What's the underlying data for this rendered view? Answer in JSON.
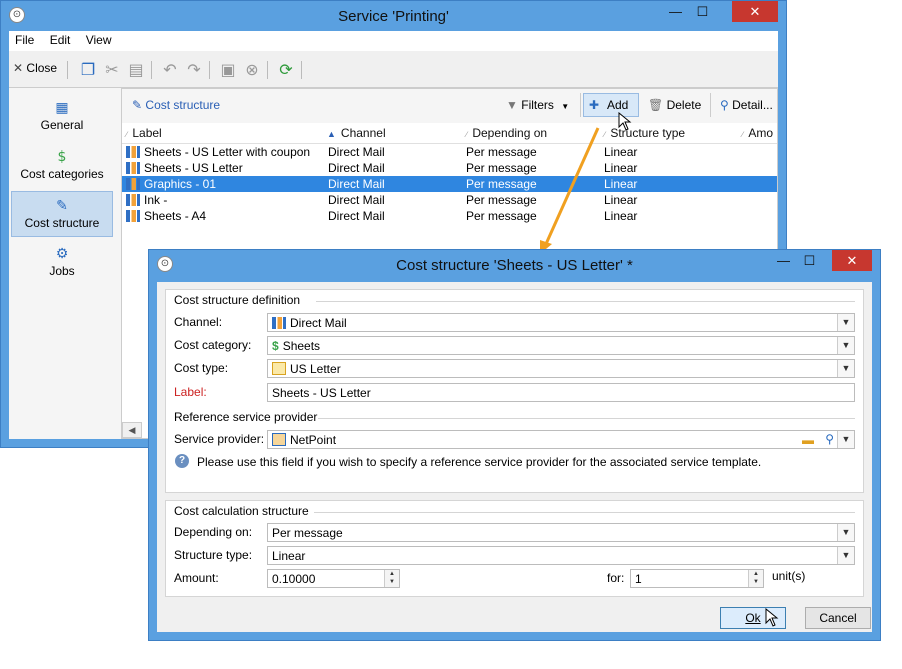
{
  "main_window": {
    "title": "Service 'Printing'",
    "menu": [
      "File",
      "Edit",
      "View"
    ],
    "toolbar": {
      "close_label": "Close"
    },
    "sidebar": [
      {
        "label": "General",
        "icon": "clipboard-icon"
      },
      {
        "label": "Cost categories",
        "icon": "money-pin-icon"
      },
      {
        "label": "Cost structure",
        "icon": "document-edit-icon",
        "selected": true
      },
      {
        "label": "Jobs",
        "icon": "gears-icon"
      }
    ],
    "panel": {
      "title": "Cost structure",
      "filters_label": "Filters",
      "add_label": "Add",
      "delete_label": "Delete",
      "detail_label": "Detail..."
    },
    "grid": {
      "columns": [
        "Label",
        "Channel",
        "Depending on",
        "Structure type",
        "Amo"
      ],
      "rows": [
        {
          "label": "Sheets - US Letter with coupon",
          "channel": "Direct Mail",
          "depending": "Per message",
          "structure": "Linear"
        },
        {
          "label": "Sheets - US Letter",
          "channel": "Direct Mail",
          "depending": "Per message",
          "structure": "Linear"
        },
        {
          "label": "Graphics - 01",
          "channel": "Direct Mail",
          "depending": "Per message",
          "structure": "Linear",
          "selected": true
        },
        {
          "label": "Ink -",
          "channel": "Direct Mail",
          "depending": "Per message",
          "structure": "Linear"
        },
        {
          "label": "Sheets - A4",
          "channel": "Direct Mail",
          "depending": "Per message",
          "structure": "Linear"
        }
      ]
    }
  },
  "dialog": {
    "title": "Cost structure 'Sheets - US Letter' *",
    "definition": {
      "section_title": "Cost structure definition",
      "channel_label": "Channel:",
      "channel_value": "Direct Mail",
      "category_label": "Cost category:",
      "category_value": "Sheets",
      "type_label": "Cost type:",
      "type_value": "US Letter",
      "label_label": "Label:",
      "label_value": "Sheets - US Letter"
    },
    "reference": {
      "section_title": "Reference service provider",
      "provider_label": "Service provider:",
      "provider_value": "NetPoint",
      "hint": "Please use this field if you wish to specify a reference service provider for the associated service template."
    },
    "calculation": {
      "section_title": "Cost calculation structure",
      "depending_label": "Depending on:",
      "depending_value": "Per message",
      "structure_label": "Structure type:",
      "structure_value": "Linear",
      "amount_label": "Amount:",
      "amount_value": "0.10000",
      "for_label": "for:",
      "for_value": "1",
      "unit_label": "unit(s)"
    },
    "ok_label": "Ok",
    "cancel_label": "Cancel"
  },
  "colors": {
    "titlebar": "#5aa0e0",
    "selection": "#2f86e0",
    "close_button": "#c7372f",
    "arrow": "#f0a020"
  }
}
